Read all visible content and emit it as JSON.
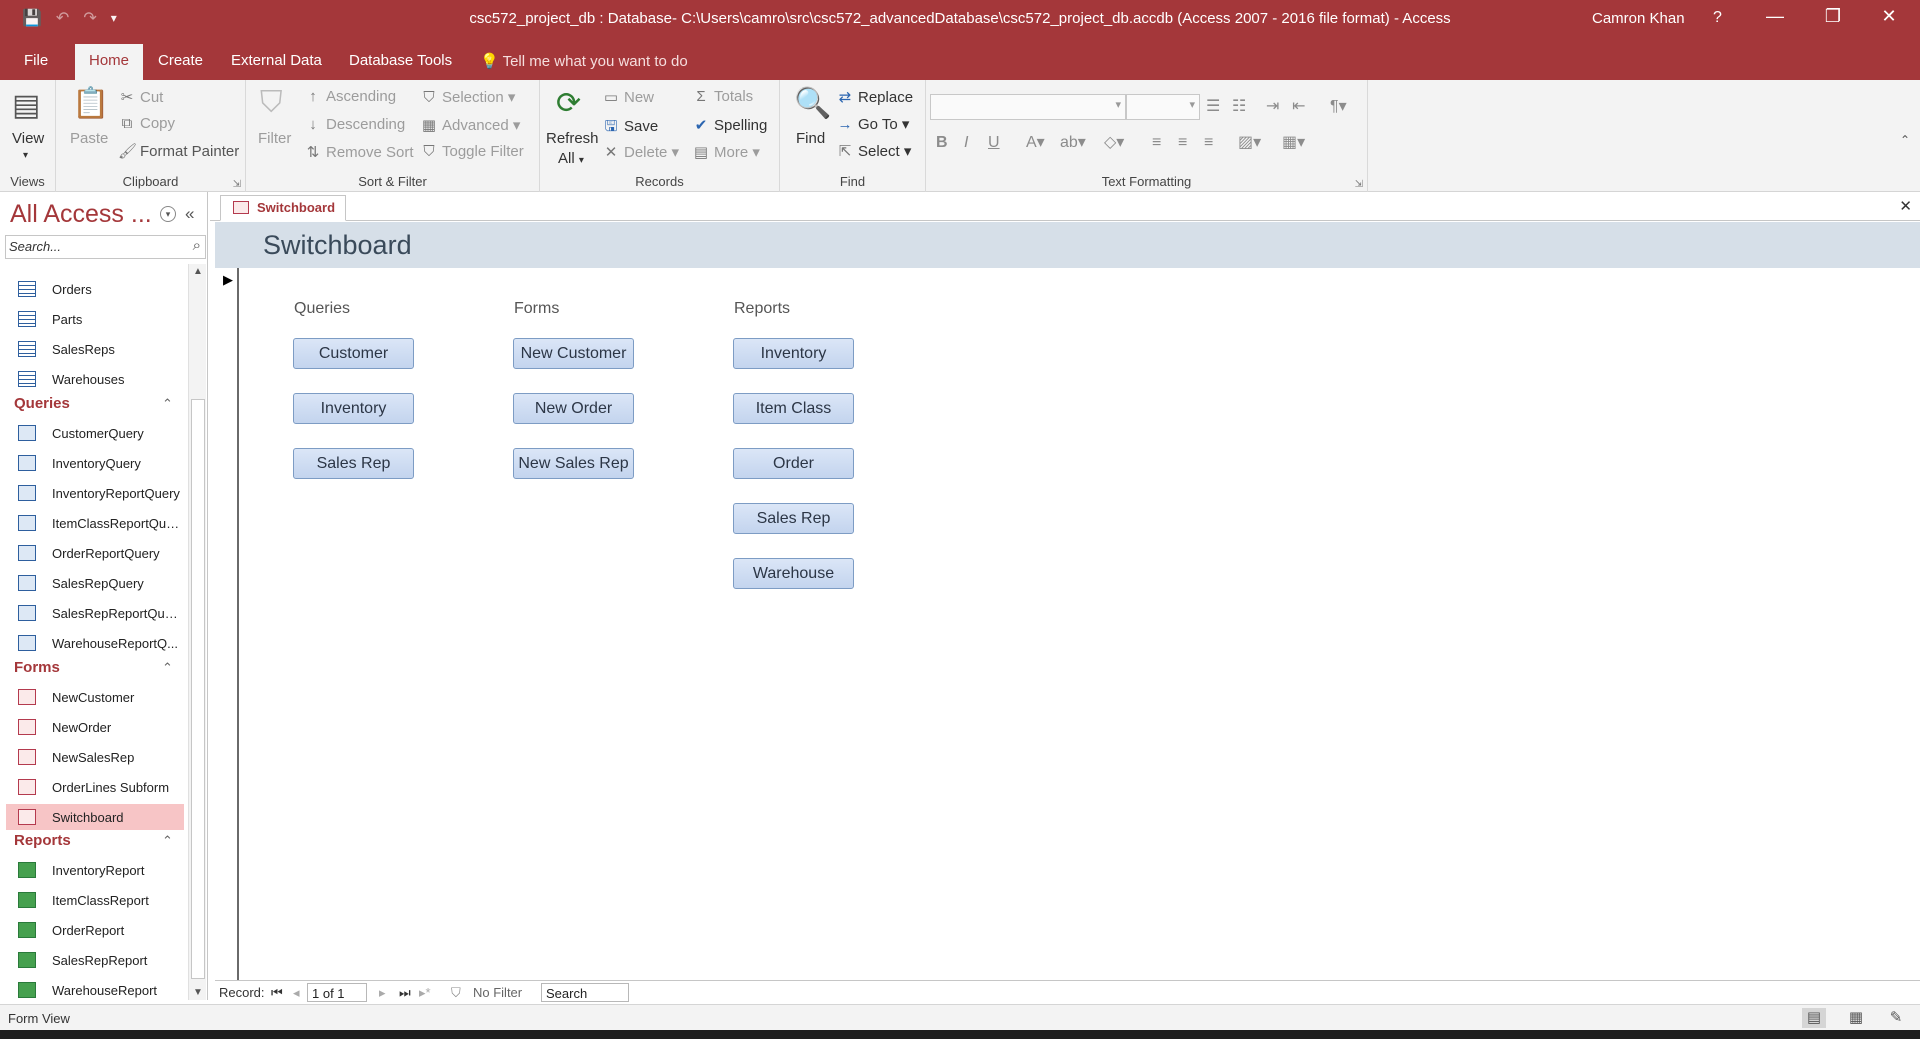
{
  "window": {
    "title": "csc572_project_db : Database- C:\\Users\\camro\\src\\csc572_advancedDatabase\\csc572_project_db.accdb (Access 2007 - 2016 file format)  -  Access",
    "user": "Camron Khan",
    "help": "?",
    "minimize": "—",
    "restore": "❐",
    "close": "✕"
  },
  "menu": {
    "tabs": [
      "File",
      "Home",
      "Create",
      "External Data",
      "Database Tools"
    ],
    "active": "Home",
    "tell_me": "Tell me what you want to do"
  },
  "ribbon": {
    "views": {
      "view": "View",
      "label": "Views"
    },
    "clipboard": {
      "paste": "Paste",
      "cut": "Cut",
      "copy": "Copy",
      "format_painter": "Format Painter",
      "label": "Clipboard"
    },
    "sort_filter": {
      "filter": "Filter",
      "ascending": "Ascending",
      "descending": "Descending",
      "remove_sort": "Remove Sort",
      "selection": "Selection",
      "advanced": "Advanced",
      "toggle_filter": "Toggle Filter",
      "label": "Sort & Filter"
    },
    "records": {
      "refresh": "Refresh",
      "refresh_all": "All",
      "new": "New",
      "save": "Save",
      "delete": "Delete",
      "totals": "Totals",
      "spelling": "Spelling",
      "more": "More",
      "label": "Records"
    },
    "find": {
      "find": "Find",
      "replace": "Replace",
      "goto": "Go To",
      "select": "Select",
      "label": "Find"
    },
    "text_formatting": {
      "label": "Text Formatting"
    }
  },
  "nav": {
    "title": "All Access ...",
    "search_placeholder": "Search...",
    "tables": [
      "Orders",
      "Parts",
      "SalesReps",
      "Warehouses"
    ],
    "queries_label": "Queries",
    "queries": [
      "CustomerQuery",
      "InventoryQuery",
      "InventoryReportQuery",
      "ItemClassReportQue...",
      "OrderReportQuery",
      "SalesRepQuery",
      "SalesRepReportQuery",
      "WarehouseReportQ..."
    ],
    "forms_label": "Forms",
    "forms": [
      "NewCustomer",
      "NewOrder",
      "NewSalesRep",
      "OrderLines Subform",
      "Switchboard"
    ],
    "reports_label": "Reports",
    "reports": [
      "InventoryReport",
      "ItemClassReport",
      "OrderReport",
      "SalesRepReport",
      "WarehouseReport"
    ],
    "selected": "Switchboard"
  },
  "document": {
    "tab": "Switchboard",
    "form_title": "Switchboard",
    "columns": [
      {
        "heading": "Queries",
        "buttons": [
          "Customer",
          "Inventory",
          "Sales Rep"
        ]
      },
      {
        "heading": "Forms",
        "buttons": [
          "New Customer",
          "New Order",
          "New Sales Rep"
        ]
      },
      {
        "heading": "Reports",
        "buttons": [
          "Inventory",
          "Item Class",
          "Order",
          "Sales Rep",
          "Warehouse"
        ]
      }
    ]
  },
  "record_nav": {
    "label": "Record:",
    "position": "1 of 1",
    "filter": "No Filter",
    "search": "Search"
  },
  "status": {
    "text": "Form View"
  }
}
